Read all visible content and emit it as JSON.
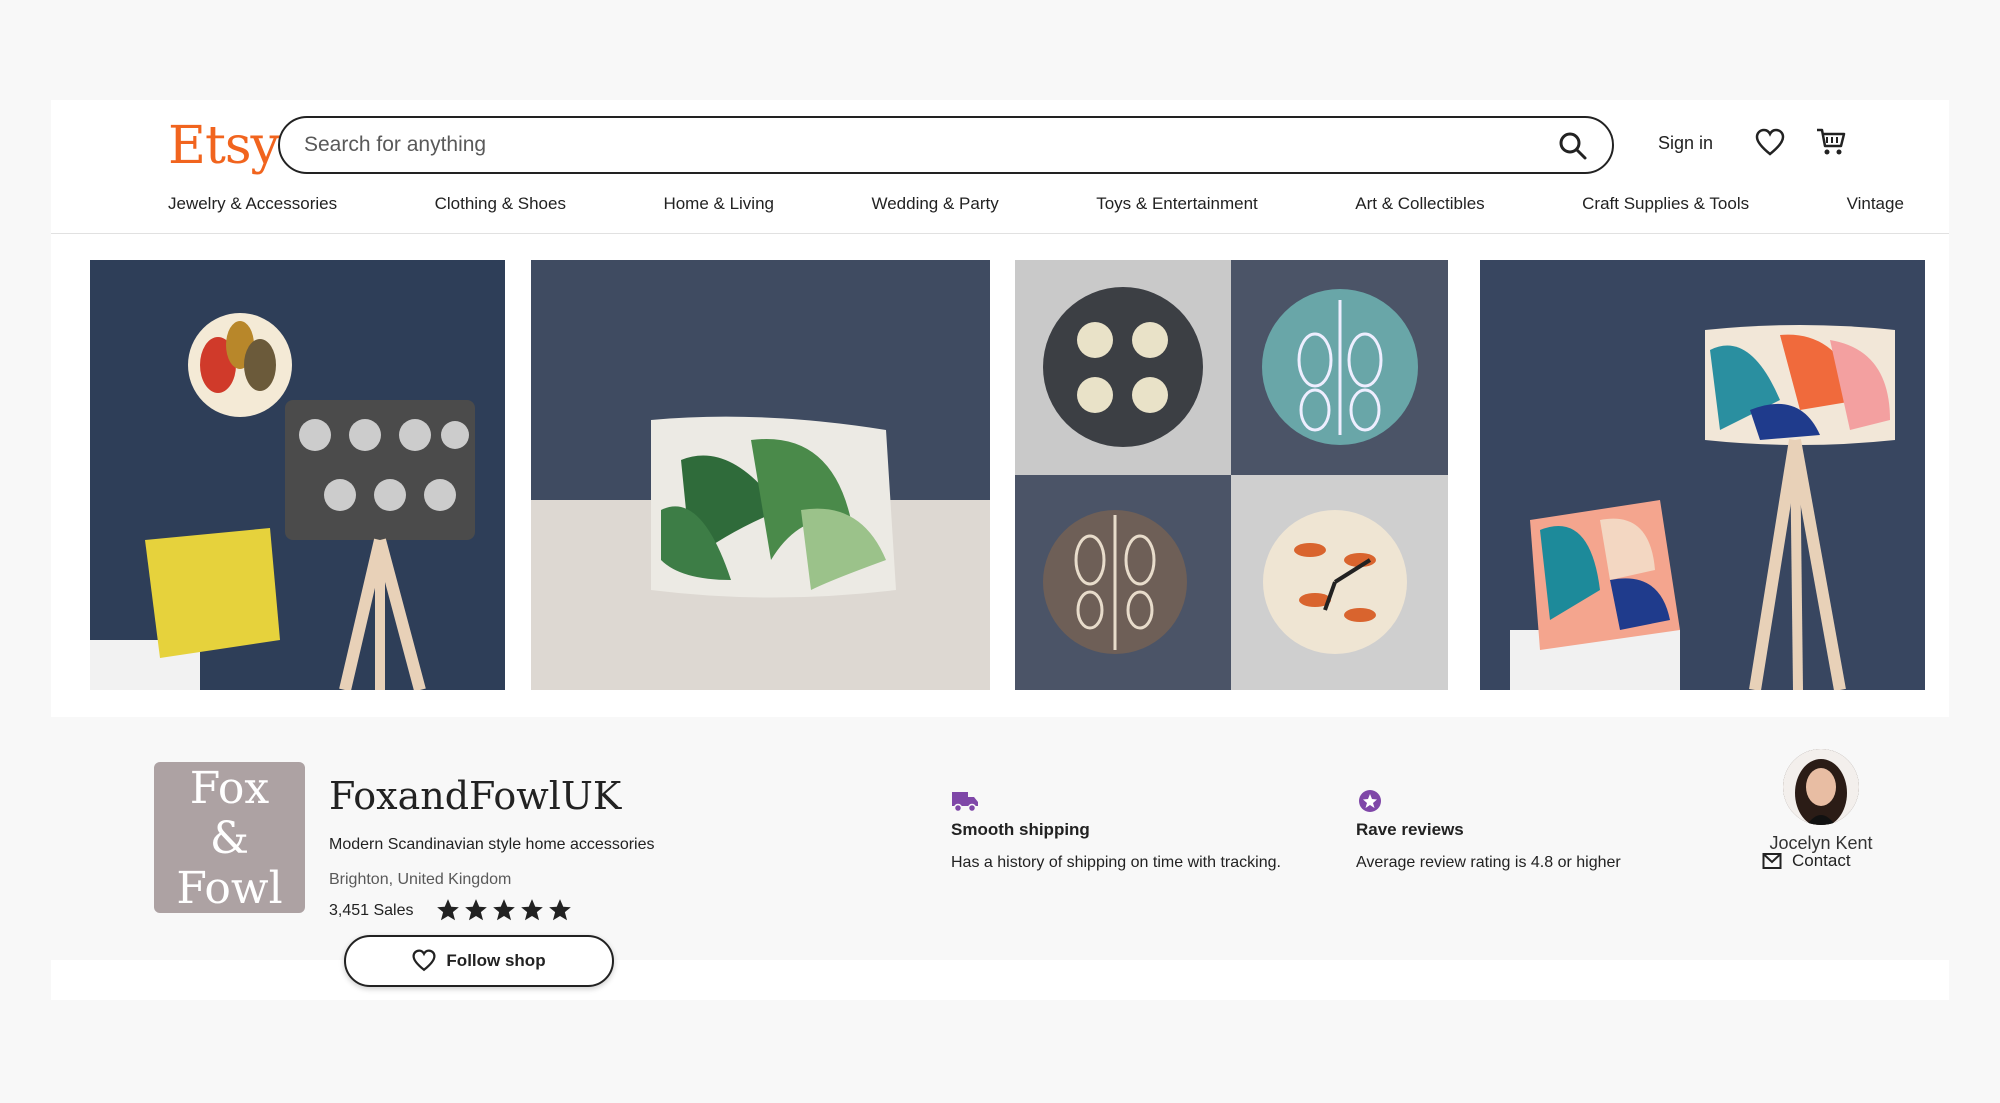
{
  "header": {
    "logo": "Etsy",
    "search_placeholder": "Search for anything",
    "sign_in": "Sign in"
  },
  "nav": {
    "items": [
      "Jewelry & Accessories",
      "Clothing & Shoes",
      "Home & Living",
      "Wedding & Party",
      "Toys & Entertainment",
      "Art & Collectibles",
      "Craft Supplies & Tools",
      "Vintage"
    ]
  },
  "banner": {
    "images": [
      "lamp-and-cushion-photo",
      "toiletry-bag-photo",
      "clocks-collage-photo",
      "tropical-lamp-photo"
    ]
  },
  "shop": {
    "logo_text": [
      "Fox",
      "&",
      "Fowl"
    ],
    "name": "FoxandFowlUK",
    "tagline": "Modern Scandinavian style home accessories",
    "location": "Brighton, United Kingdom",
    "sales": "3,451 Sales",
    "rating": 5,
    "follow": "Follow shop"
  },
  "features": [
    {
      "icon": "truck-icon",
      "title": "Smooth shipping",
      "desc": "Has a history of shipping on time with tracking."
    },
    {
      "icon": "star-badge-icon",
      "title": "Rave reviews",
      "desc": "Average review rating is 4.8 or higher"
    }
  ],
  "owner": {
    "name": "Jocelyn Kent",
    "contact": "Contact"
  },
  "colors": {
    "brand": "#f1641e",
    "accent": "#7f47a8"
  }
}
